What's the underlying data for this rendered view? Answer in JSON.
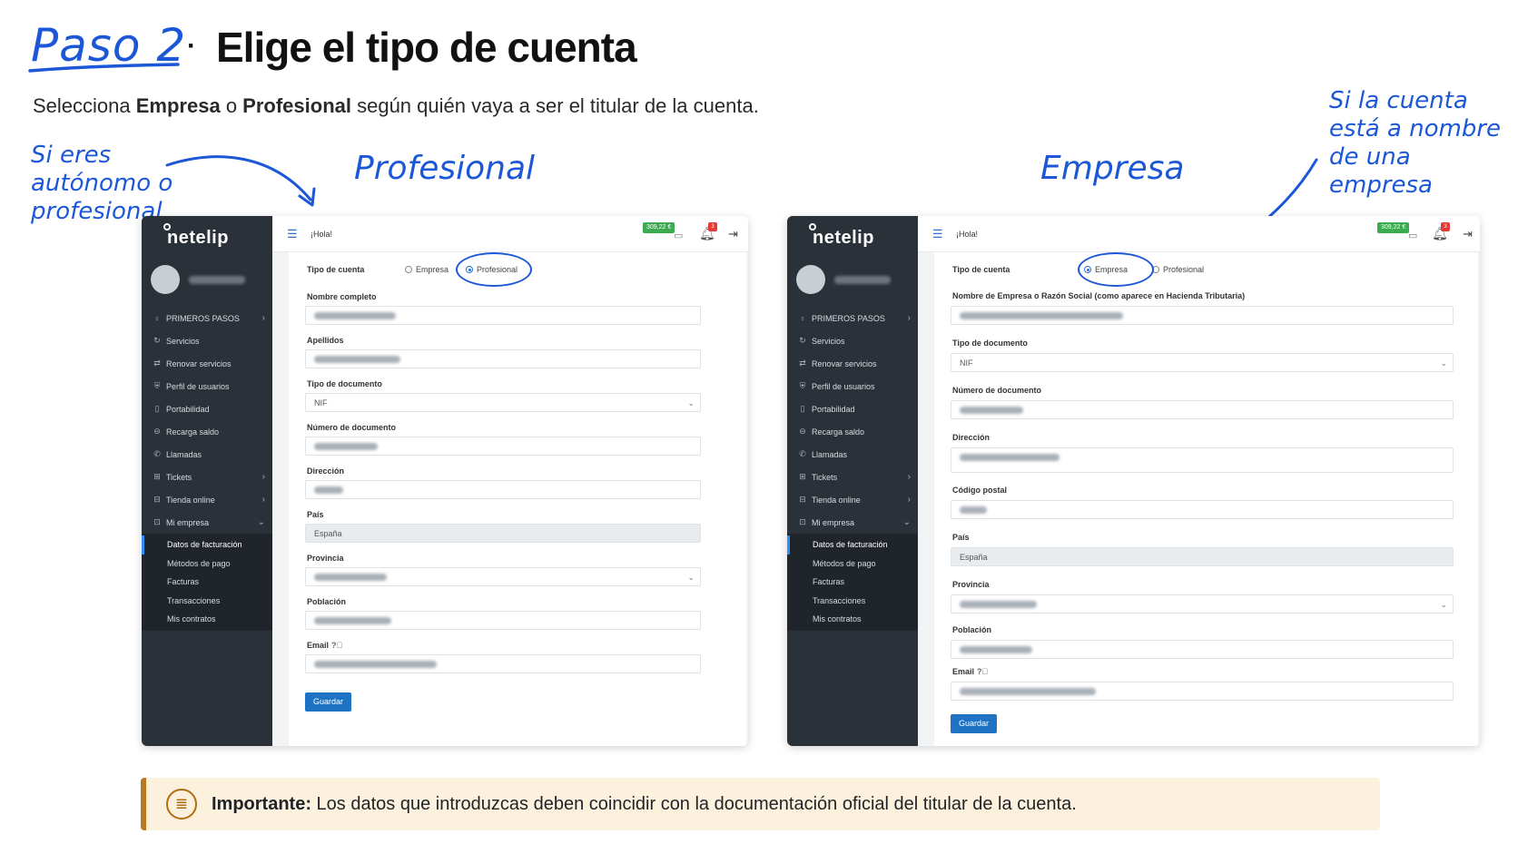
{
  "header": {
    "step": "Paso 2",
    "separator": "·",
    "title": "Elige el tipo de cuenta",
    "subtitle_pre": "Selecciona ",
    "subtitle_opt1": "Empresa",
    "subtitle_mid": " o ",
    "subtitle_opt2": "Profesional",
    "subtitle_post": " según quién vaya a ser el titular de la cuenta."
  },
  "annotations": {
    "left_note": "Si eres autónomo o profesional",
    "right_note": "Si la cuenta está a nombre de una empresa",
    "label_profesional": "Profesional",
    "label_empresa": "Empresa"
  },
  "app": {
    "brand": "netelip",
    "greeting": "¡Hola!",
    "balance": "309,22 €",
    "notification_count": "3",
    "menu": [
      {
        "label": "PRIMEROS PASOS",
        "icon": "lightbulb-icon",
        "glyph": "♀",
        "chevron": "›"
      },
      {
        "label": "Servicios",
        "icon": "refresh-icon",
        "glyph": "↻",
        "chevron": ""
      },
      {
        "label": "Renovar servicios",
        "icon": "renew-icon",
        "glyph": "⇄",
        "chevron": ""
      },
      {
        "label": "Perfil de usuarios",
        "icon": "shield-icon",
        "glyph": "⛨",
        "chevron": ""
      },
      {
        "label": "Portabilidad",
        "icon": "document-icon",
        "glyph": "▯",
        "chevron": ""
      },
      {
        "label": "Recarga saldo",
        "icon": "money-icon",
        "glyph": "⊖",
        "chevron": ""
      },
      {
        "label": "Llamadas",
        "icon": "phone-icon",
        "glyph": "✆",
        "chevron": ""
      },
      {
        "label": "Tickets",
        "icon": "ticket-icon",
        "glyph": "⊞",
        "chevron": "›"
      },
      {
        "label": "Tienda online",
        "icon": "store-icon",
        "glyph": "⊟",
        "chevron": "›"
      },
      {
        "label": "Mi empresa",
        "icon": "building-icon",
        "glyph": "⊡",
        "chevron": "⌄"
      }
    ],
    "submenu": [
      {
        "label": "Datos de facturación",
        "active": true
      },
      {
        "label": "Métodos de pago",
        "active": false
      },
      {
        "label": "Facturas",
        "active": false
      },
      {
        "label": "Transacciones",
        "active": false
      },
      {
        "label": "Mis contratos",
        "active": false
      }
    ],
    "account_type_label": "Tipo de cuenta",
    "option_empresa": "Empresa",
    "option_profesional": "Profesional",
    "save_label": "Guardar"
  },
  "form_profesional": {
    "selected": "Profesional",
    "name_label": "Nombre completo",
    "surname_label": "Apellidos",
    "doctype_label": "Tipo de documento",
    "doctype_value": "NIF",
    "docnum_label": "Número de documento",
    "address_label": "Dirección",
    "country_label": "País",
    "country_value": "España",
    "province_label": "Provincia",
    "city_label": "Población",
    "email_label": "Email"
  },
  "form_empresa": {
    "selected": "Empresa",
    "company_label": "Nombre de Empresa o Razón Social (como aparece en Hacienda Tributaria)",
    "doctype_label": "Tipo de documento",
    "doctype_value": "NIF",
    "docnum_label": "Número de documento",
    "address_label": "Dirección",
    "postal_label": "Código postal",
    "country_label": "País",
    "country_value": "España",
    "province_label": "Provincia",
    "city_label": "Población",
    "email_label": "Email"
  },
  "notice": {
    "bold": "Importante:",
    "text": " Los datos que introduzcas deben coincidir con la documentación oficial del titular de la cuenta.",
    "icon": "document-icon"
  },
  "colors": {
    "accent_blue": "#1b57d6",
    "sidebar_bg": "#2b3138",
    "button_blue": "#1f73c4",
    "notice_bg": "#fcf1dd",
    "notice_border": "#b87a1e"
  }
}
